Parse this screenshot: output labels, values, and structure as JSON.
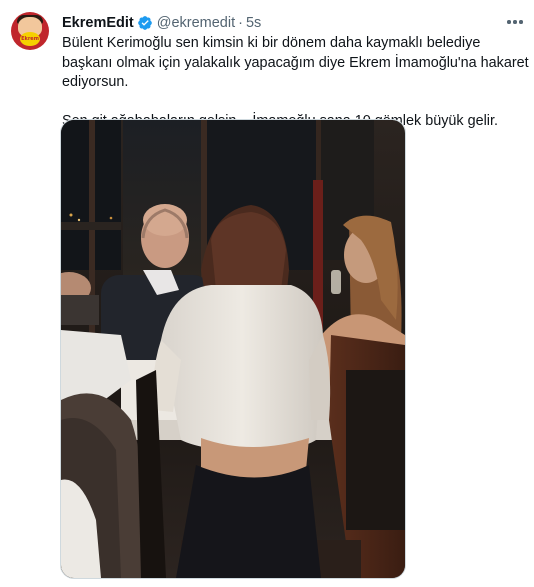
{
  "tweet": {
    "display_name": "EkremEdit",
    "handle": "@ekremedit",
    "separator": "·",
    "time": "5s",
    "avatar_text": "Ekrem Edit",
    "text_line1": "Bülent Kerimoğlu sen kimsin ki bir dönem daha kaymaklı belediye başkanı olmak için yalakalık yapacağım diye Ekrem İmamoğlu'na hakaret ediyorsun.",
    "text_line2": "Sen git ağababaların gelsin... İmamoğlu sana 10 gömlek büyük gelir."
  },
  "icons": {
    "verified": "verified-badge-icon",
    "more": "more-options-icon"
  },
  "colors": {
    "verified": "#1d9bf0",
    "secondary_text": "#536471",
    "primary_text": "#0f1419",
    "border": "#cfd9de"
  }
}
